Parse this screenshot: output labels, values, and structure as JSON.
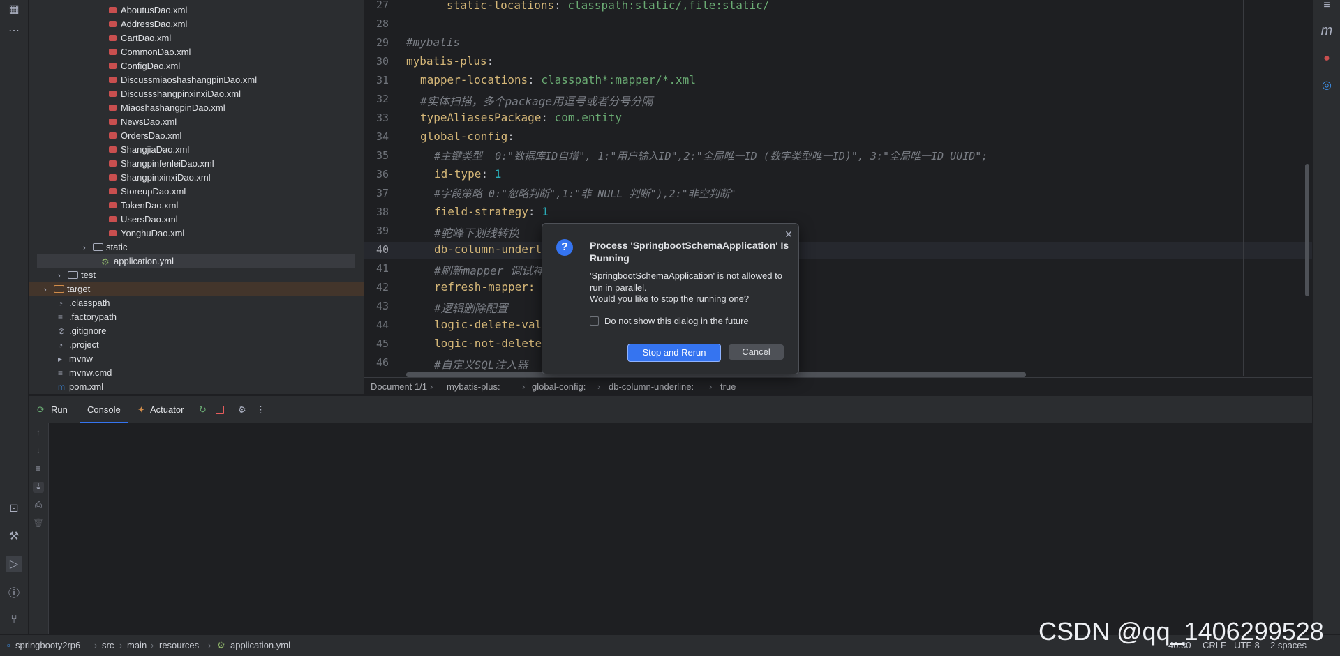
{
  "project_tree": {
    "mapper_files": [
      "AboutusDao.xml",
      "AddressDao.xml",
      "CartDao.xml",
      "CommonDao.xml",
      "ConfigDao.xml",
      "DiscussmiaoshashangpinDao.xml",
      "DiscussshangpinxinxiDao.xml",
      "MiaoshashangpinDao.xml",
      "NewsDao.xml",
      "OrdersDao.xml",
      "ShangjiaDao.xml",
      "ShangpinfenleiDao.xml",
      "ShangpinxinxiDao.xml",
      "StoreupDao.xml",
      "TokenDao.xml",
      "UsersDao.xml",
      "YonghuDao.xml"
    ],
    "static_folder": "static",
    "application_yml": "application.yml",
    "test_folder": "test",
    "target_folder": "target",
    "root_files": [
      ".classpath",
      ".factorypath",
      ".gitignore",
      ".project",
      "mvnw",
      "mvnw.cmd",
      "pom.xml"
    ]
  },
  "editor": {
    "line_numbers": [
      "27",
      "28",
      "29",
      "30",
      "31",
      "32",
      "33",
      "34",
      "35",
      "36",
      "37",
      "38",
      "39",
      "40",
      "41",
      "42",
      "43",
      "44",
      "45",
      "46"
    ],
    "lines": {
      "l27_key": "static-locations",
      "l27_val": "classpath:static/,file:static/",
      "l29": "#mybatis",
      "l30": "mybatis-plus",
      "l31_key": "mapper-locations",
      "l31_val": "classpath*:mapper/*.xml",
      "l32": "#实体扫描，多个package用逗号或者分号分隔",
      "l33_key": "typeAliasesPackage",
      "l33_val": "com.entity",
      "l34": "global-config",
      "l35": "#主键类型  0:\"数据库ID自增\", 1:\"用户输入ID\",2:\"全局唯一ID (数字类型唯一ID)\", 3:\"全局唯一ID UUID\";",
      "l36_key": "id-type",
      "l36_val": "1",
      "l37": "#字段策略 0:\"忽略判断\",1:\"非 NULL 判断\"),2:\"非空判断\"",
      "l38_key": "field-strategy",
      "l38_val": "1",
      "l39": "#驼峰下划线转换",
      "l40": "db-column-underl",
      "l41": "#刷新mapper 调试神",
      "l42": "refresh-mapper:",
      "l43": "#逻辑删除配置",
      "l44": "logic-delete-val",
      "l45": "logic-not-delete",
      "l46": "#自定义SQL注入器"
    }
  },
  "breadcrumbs": [
    "Document 1/1",
    "mybatis-plus:",
    "global-config:",
    "db-column-underline:",
    "true"
  ],
  "run_panel": {
    "tabs": [
      "Run",
      "Console",
      "Actuator"
    ]
  },
  "dialog": {
    "title": "Process 'SpringbootSchemaApplication' Is Running",
    "message": "'SpringbootSchemaApplication' is not allowed to run in parallel.",
    "question": "Would you like to stop the running one?",
    "checkbox_label": "Do not show this dialog in the future",
    "primary_button": "Stop and Rerun",
    "cancel_button": "Cancel"
  },
  "status_bar": {
    "path": [
      "springbooty2rp6",
      "src",
      "main",
      "resources",
      "application.yml"
    ],
    "position": "40:30",
    "line_ending": "CRLF",
    "encoding": "UTF-8",
    "indent": "2 spaces"
  },
  "watermark": "CSDN @qq_1406299528",
  "colors": {
    "accent": "#3574f0",
    "keyword": "#d5b778",
    "string": "#6aab73",
    "number": "#2aacb8",
    "comment": "#7a7e85"
  }
}
